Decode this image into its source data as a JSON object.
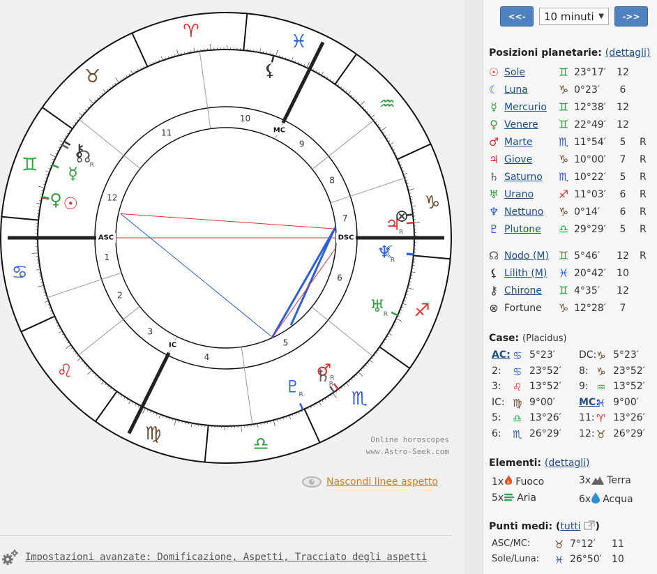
{
  "chart": {
    "watermark_line1": "Online horoscopes",
    "watermark_line2": "www.Astro-Seek.com",
    "angle_labels": {
      "asc": "ASC",
      "dsc": "DSC",
      "mc": "MC",
      "ic": "IC"
    },
    "house_numbers": [
      "1",
      "2",
      "3",
      "4",
      "5",
      "6",
      "7",
      "8",
      "9",
      "10",
      "11",
      "12"
    ],
    "sign_glyphs": {
      "aries": "♈",
      "taurus": "♉",
      "gemini": "♊",
      "cancer": "♋",
      "leo": "♌",
      "virgo": "♍",
      "libra": "♎",
      "scorpio": "♏",
      "sagittarius": "♐",
      "capricorn": "♑",
      "aquarius": "♒",
      "pisces": "♓"
    },
    "retro_mark": "R"
  },
  "links": {
    "hide_aspect_lines": "Nascondi linee aspetto",
    "advanced_settings": "Impostazioni avanzate: Domificazione, Aspetti, Tracciato degli aspetti"
  },
  "nav": {
    "prev": "<<-",
    "next": "->>",
    "step_value": "10 minuti"
  },
  "planets_section": {
    "title": "Posizioni planetarie:",
    "details_link": "(dettagli)",
    "rows": [
      {
        "icon": "☉",
        "name": "Sole",
        "sign": "♊",
        "sign_color": "#2e9e3e",
        "deg": "23°17′",
        "house": "12",
        "retro": "",
        "icon_color": "#e03030"
      },
      {
        "icon": "☾",
        "name": "Luna",
        "sign": "♑",
        "sign_color": "#6a4a2a",
        "deg": "0°23′",
        "house": "6",
        "retro": "",
        "icon_color": "#2c5fd6"
      },
      {
        "icon": "☿",
        "name": "Mercurio",
        "sign": "♊",
        "sign_color": "#2e9e3e",
        "deg": "12°38′",
        "house": "12",
        "retro": "",
        "icon_color": "#2e9e3e"
      },
      {
        "icon": "♀",
        "name": "Venere",
        "sign": "♊",
        "sign_color": "#2e9e3e",
        "deg": "22°49′",
        "house": "12",
        "retro": "",
        "icon_color": "#2e9e3e"
      },
      {
        "icon": "♂",
        "name": "Marte",
        "sign": "♏",
        "sign_color": "#2c5fd6",
        "deg": "11°54′",
        "house": "5",
        "retro": "R",
        "icon_color": "#e03030"
      },
      {
        "icon": "♃",
        "name": "Giove",
        "sign": "♑",
        "sign_color": "#6a4a2a",
        "deg": "10°00′",
        "house": "7",
        "retro": "R",
        "icon_color": "#e03030"
      },
      {
        "icon": "♄",
        "name": "Saturno",
        "sign": "♏",
        "sign_color": "#2c5fd6",
        "deg": "10°22′",
        "house": "5",
        "retro": "R",
        "icon_color": "#555555"
      },
      {
        "icon": "♅",
        "name": "Urano",
        "sign": "♐",
        "sign_color": "#e03030",
        "deg": "11°03′",
        "house": "6",
        "retro": "R",
        "icon_color": "#2e9e3e"
      },
      {
        "icon": "♆",
        "name": "Nettuno",
        "sign": "♑",
        "sign_color": "#6a4a2a",
        "deg": "0°14′",
        "house": "6",
        "retro": "R",
        "icon_color": "#2c5fd6"
      },
      {
        "icon": "♇",
        "name": "Plutone",
        "sign": "♎",
        "sign_color": "#2e9e3e",
        "deg": "29°29′",
        "house": "5",
        "retro": "R",
        "icon_color": "#2c5fd6"
      }
    ],
    "extra_rows": [
      {
        "icon": "☊",
        "name": "Nodo (M)",
        "sign": "♊",
        "sign_color": "#2e9e3e",
        "deg": "5°46′",
        "house": "12",
        "retro": "R",
        "icon_color": "#555555"
      },
      {
        "icon": "⚸",
        "name": "Lilith (M)",
        "sign": "♓",
        "sign_color": "#2c5fd6",
        "deg": "20°42′",
        "house": "10",
        "retro": "",
        "icon_color": "#333333"
      },
      {
        "icon": "⚷",
        "name": "Chirone",
        "sign": "♊",
        "sign_color": "#2e9e3e",
        "deg": "4°35′",
        "house": "12",
        "retro": "",
        "icon_color": "#333333"
      },
      {
        "icon": "⊗",
        "name": "Fortune",
        "sign": "♑",
        "sign_color": "#6a4a2a",
        "deg": "12°28′",
        "house": "7",
        "retro": "",
        "icon_color": "#333333",
        "plain": true
      }
    ]
  },
  "houses_section": {
    "title": "Case:",
    "system": "(Placidus)",
    "rows": [
      {
        "l1": "AC:",
        "s1": "♋",
        "c1": "#2c5fd6",
        "v1": "5°23′",
        "l2": "DC:",
        "s2": "♑",
        "c2": "#6a4a2a",
        "v2": "5°23′",
        "link1": true
      },
      {
        "l1": "2:",
        "s1": "♋",
        "c1": "#2c5fd6",
        "v1": "23°52′",
        "l2": "8:",
        "s2": "♑",
        "c2": "#6a4a2a",
        "v2": "23°52′"
      },
      {
        "l1": "3:",
        "s1": "♌",
        "c1": "#e03030",
        "v1": "13°52′",
        "l2": "9:",
        "s2": "♒",
        "c2": "#2e9e3e",
        "v2": "13°52′"
      },
      {
        "l1": "IC:",
        "s1": "♍",
        "c1": "#6a4a2a",
        "v1": "9°00′",
        "l2": "MC:",
        "s2": "♓",
        "c2": "#2c5fd6",
        "v2": "9°00′",
        "link2": true
      },
      {
        "l1": "5:",
        "s1": "♎",
        "c1": "#2e9e3e",
        "v1": "13°26′",
        "l2": "11:",
        "s2": "♈",
        "c2": "#e03030",
        "v2": "13°26′"
      },
      {
        "l1": "6:",
        "s1": "♏",
        "c1": "#2c5fd6",
        "v1": "26°29′",
        "l2": "12:",
        "s2": "♉",
        "c2": "#6a4a2a",
        "v2": "26°29′"
      }
    ]
  },
  "elements_section": {
    "title": "Elementi:",
    "details_link": "(dettagli)",
    "items": [
      {
        "count": "1x",
        "label": "Fuoco",
        "icon": "fire-icon"
      },
      {
        "count": "3x",
        "label": "Terra",
        "icon": "mountain-icon"
      },
      {
        "count": "5x",
        "label": "Aria",
        "icon": "wind-icon"
      },
      {
        "count": "6x",
        "label": "Acqua",
        "icon": "water-drop-icon"
      }
    ]
  },
  "midpoints_section": {
    "title": "Punti medi:",
    "all_link": "tutti",
    "rows": [
      {
        "label": "ASC/MC:",
        "sign": "♉",
        "color": "#6a4a2a",
        "deg": "7°12′",
        "house": "11"
      },
      {
        "label": "Sole/Luna:",
        "sign": "♓",
        "color": "#2c5fd6",
        "deg": "26°50′",
        "house": "10"
      }
    ]
  },
  "colors": {
    "fire": "#e03030",
    "earth": "#6a4a2a",
    "air": "#2e9e3e",
    "water": "#2c5fd6",
    "link": "#1c4d8c",
    "orange_link": "#e07b1a",
    "button": "#4e81c0"
  }
}
